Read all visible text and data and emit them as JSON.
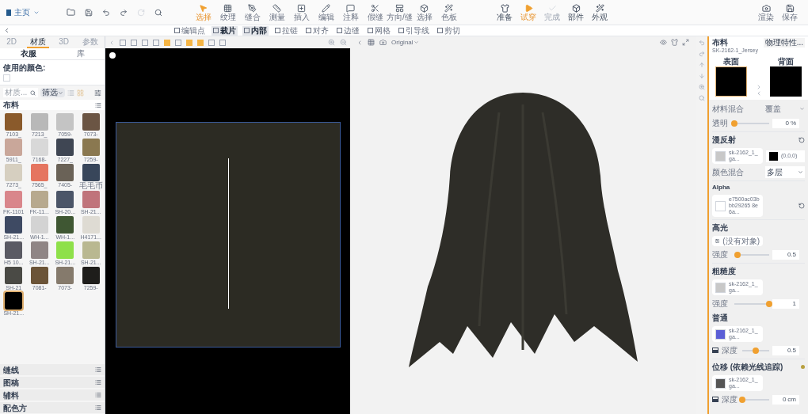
{
  "top_toolbar": {
    "home": "主页",
    "tools": [
      {
        "label": "选择",
        "selected": true
      },
      {
        "label": "纹理",
        "selected": false
      },
      {
        "label": "缝合",
        "selected": false
      },
      {
        "label": "测量",
        "selected": false
      },
      {
        "label": "插入",
        "selected": false
      },
      {
        "label": "编辑",
        "selected": false
      },
      {
        "label": "注释",
        "selected": false
      },
      {
        "label": "假缝",
        "selected": false
      },
      {
        "label": "方向/缝",
        "selected": false
      },
      {
        "label": "选择",
        "selected": false
      },
      {
        "label": "色板",
        "selected": false
      }
    ],
    "sim_tools": [
      {
        "label": "准备",
        "selected": false,
        "disabled": false
      },
      {
        "label": "试穿",
        "selected": true,
        "disabled": false
      },
      {
        "label": "完成",
        "selected": false,
        "disabled": true
      },
      {
        "label": "部件",
        "selected": false,
        "disabled": false
      },
      {
        "label": "外观",
        "selected": false,
        "disabled": false
      }
    ],
    "right_tools": [
      "渲染",
      "保存"
    ]
  },
  "edit_toolbar": [
    {
      "label": "编辑点",
      "selected": false
    },
    {
      "label": "裁片",
      "selected": true
    },
    {
      "label": "内部",
      "selected": true
    },
    {
      "label": "拉链",
      "selected": false
    },
    {
      "label": "对齐",
      "selected": false
    },
    {
      "label": "边缝",
      "selected": false
    },
    {
      "label": "网格",
      "selected": false
    },
    {
      "label": "引导线",
      "selected": false
    },
    {
      "label": "剪切",
      "selected": false
    }
  ],
  "left_panel": {
    "tabs": [
      {
        "label": "2D",
        "selected": false
      },
      {
        "label": "材质",
        "selected": true
      },
      {
        "label": "3D",
        "selected": false
      },
      {
        "label": "参数",
        "selected": false
      }
    ],
    "subtabs": [
      {
        "label": "衣服",
        "selected": true
      },
      {
        "label": "库",
        "selected": false
      }
    ],
    "used_colors_label": "使用的颜色:",
    "search": {
      "placeholder": "材质...",
      "filter": "筛选"
    },
    "fabric_header": "布料",
    "swatches": [
      {
        "label": "7103_",
        "color": "#8a5a2b",
        "selected": false
      },
      {
        "label": "7213_",
        "color": "#b8b8b8",
        "selected": false
      },
      {
        "label": "7059-",
        "color": "#c4c4c4",
        "selected": false
      },
      {
        "label": "7073-",
        "color": "#6b5544",
        "selected": false
      },
      {
        "label": "5911_",
        "color": "#c9a79a",
        "selected": false
      },
      {
        "label": "7168-",
        "color": "#d8d8d8",
        "selected": false
      },
      {
        "label": "7227_",
        "color": "#3f4653",
        "selected": false
      },
      {
        "label": "7259-",
        "color": "#8a7850",
        "selected": false
      },
      {
        "label": "7273_",
        "color": "#d6cfc0",
        "selected": false
      },
      {
        "label": "7565_",
        "color": "#e57560",
        "selected": false
      },
      {
        "label": "7405-",
        "color": "#6a6257",
        "selected": false
      },
      {
        "label": "毛毛币",
        "color": "#38465a",
        "selected": false
      },
      {
        "label": "FK-1101",
        "color": "#d9868b",
        "selected": false
      },
      {
        "label": "FK-11...",
        "color": "#b7a98e",
        "selected": false
      },
      {
        "label": "SH-20...",
        "color": "#4b5568",
        "selected": false
      },
      {
        "label": "SH-21...",
        "color": "#c0747b",
        "selected": false
      },
      {
        "label": "SH-21...",
        "color": "#3e4a63",
        "selected": false
      },
      {
        "label": "WH-1...",
        "color": "#d3d3d3",
        "selected": false
      },
      {
        "label": "WH-1...",
        "color": "#3f5733",
        "selected": false
      },
      {
        "label": "H4171...",
        "color": "#dedbd3",
        "selected": false
      },
      {
        "label": "H5 10...",
        "color": "#5a5a63",
        "selected": false
      },
      {
        "label": "SH-21...",
        "color": "#8f8585",
        "selected": false
      },
      {
        "label": "SH-21...",
        "color": "#8ee04a",
        "selected": false
      },
      {
        "label": "SH-21...",
        "color": "#b9b891",
        "selected": false
      },
      {
        "label": "SH-21",
        "color": "#4a4a45",
        "selected": false
      },
      {
        "label": "7081-",
        "color": "#6b5438",
        "selected": false
      },
      {
        "label": "7073-",
        "color": "#857a6c",
        "selected": false
      },
      {
        "label": "7259-",
        "color": "#1e1d1b",
        "selected": false
      },
      {
        "label": "SH-21...",
        "color": "#000000",
        "selected": true
      }
    ],
    "sections": [
      "缝线",
      "图稿",
      "辅料",
      "配色方"
    ]
  },
  "viewport_3d": {
    "view_mode": "Original"
  },
  "property_panel": {
    "title": "布料",
    "name": "SK-2162-1_Jersey",
    "physics_button": "物理特性...",
    "front_label": "表面",
    "back_label": "背面",
    "material_blend": {
      "label": "材料混合",
      "value": "覆盖",
      "disabled": true
    },
    "opacity": {
      "label": "透明",
      "level": 0,
      "value": "0",
      "unit": "%"
    },
    "diffuse": {
      "title": "漫反射",
      "texture": "sk-2162_1_ga...",
      "color_value": "(0,0,0)",
      "color": "#000000"
    },
    "color_blend": {
      "label": "颜色混合",
      "value": "多层"
    },
    "alpha": {
      "title": "Alpha",
      "texture": "e7500ac03bbb29265 8e6a..."
    },
    "specular": {
      "title": "高光",
      "texture": "(没有对象)",
      "intensity_label": "强度",
      "level": 0.1,
      "value": "0.5"
    },
    "roughness": {
      "title": "粗糙度",
      "texture": "sk-2162_1_ga...",
      "intensity_label": "强度",
      "level": 1,
      "value": "1"
    },
    "normal": {
      "title": "普通",
      "texture": "sk-2162_1_ga...",
      "color": "#5b5fd6",
      "depth_label": "深度",
      "level": 0.5,
      "value": "0.5"
    },
    "displacement": {
      "title": "位移 (依赖光线追踪)",
      "texture": "sk-2162_1_ga...",
      "depth_label": "深度",
      "level": 0,
      "value": "0",
      "unit": "cm"
    }
  }
}
